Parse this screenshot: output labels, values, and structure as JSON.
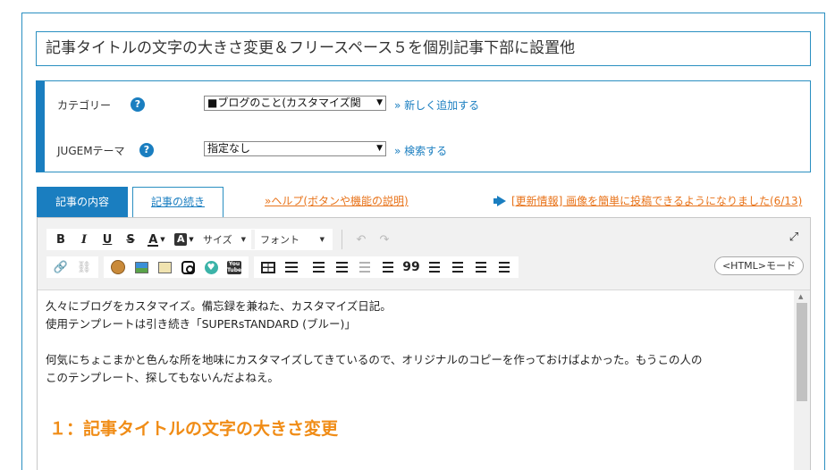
{
  "title": {
    "value": "記事タイトルの文字の大きさ変更＆フリースペース５を個別記事下部に設置他"
  },
  "meta": {
    "category": {
      "label": "カテゴリー",
      "help": "?",
      "selected": "■ブログのこと(カスタマイズ関",
      "link": "» 新しく追加する"
    },
    "theme": {
      "label": "JUGEMテーマ",
      "help": "?",
      "selected": "指定なし",
      "link": "» 検索する"
    }
  },
  "tabs": {
    "content": "記事の内容",
    "continued": "記事の続き"
  },
  "links": {
    "help": "»ヘルプ(ボタンや機能の説明)",
    "news": "[更新情報] 画像を簡単に投稿できるようになりました(6/13)"
  },
  "toolbar": {
    "bold": "B",
    "italic": "I",
    "underline": "U",
    "strike": "S",
    "font_color": "A",
    "bg_color": "A",
    "size": "サイズ",
    "font": "フォント",
    "undo": "↶",
    "redo": "↷",
    "blockquote": "99",
    "html_mode": "<HTML>モード",
    "youtube": "You Tube"
  },
  "content": {
    "line1": "久々にブログをカスタマイズ。備忘録を兼ねた、カスタマイズ日記。",
    "line2": "使用テンプレートは引き続き「SUPERsTANDARD (ブルー)」",
    "line3": "何気にちょこまかと色んな所を地味にカスタマイズしてきているので、オリジナルのコピーを作っておけばよかった。もうこの人の",
    "line4": "このテンプレート、探してもないんだよねえ。",
    "heading": "１：記事タイトルの文字の大きさ変更"
  },
  "colors": {
    "primary": "#1a7ec0",
    "accent_orange": "#f08c16",
    "link_orange": "#e8731a"
  }
}
